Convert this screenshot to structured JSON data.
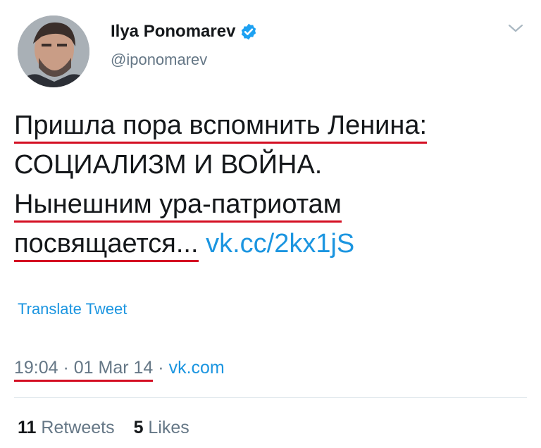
{
  "user": {
    "name": "Ilya Ponomarev",
    "handle": "@iponomarev",
    "verified": true
  },
  "tweet": {
    "lines": [
      "Пришла пора вспомнить Ленина:",
      "СОЦИАЛИЗМ И ВОЙНА.",
      "Нынешним ура-патриотам",
      "посвящается..."
    ],
    "link": "vk.cc/2kx1jS"
  },
  "translate_label": "Translate Tweet",
  "meta": {
    "time_date": "19:04 · 01 Mar 14",
    "separator": " · ",
    "source": "vk.com"
  },
  "stats": {
    "retweets_count": "11",
    "retweets_label": "Retweets",
    "likes_count": "5",
    "likes_label": "Likes"
  },
  "colors": {
    "accent": "#1b95e0",
    "underline": "#d40f23",
    "text": "#14171a",
    "muted": "#657786"
  },
  "icons": {
    "verified": "verified-badge-icon",
    "menu": "chevron-down-icon"
  }
}
